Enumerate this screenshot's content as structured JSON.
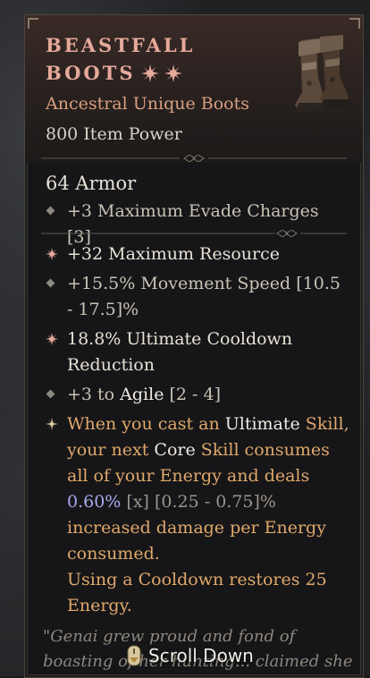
{
  "item": {
    "name_line1": "BEASTFALL",
    "name_line2": "BOOTS",
    "type": "Ancestral Unique Boots",
    "item_power": "800 Item Power",
    "armor": "64 Armor",
    "implicit": "+3 Maximum Evade Charges [3]",
    "affixes": [
      {
        "icon": "greater-affix-icon",
        "text": "+32 Maximum Resource"
      },
      {
        "icon": "diamond-bullet-icon",
        "text": "+15.5% Movement Speed [10.5 - 17.5]%"
      },
      {
        "icon": "greater-affix-icon",
        "text": "18.8% Ultimate Cooldown Reduction"
      },
      {
        "icon": "diamond-bullet-icon",
        "text_prefix": "+3 to ",
        "text_highlight": "Agile",
        "text_suffix": " [2 - 4]"
      }
    ],
    "unique_power": {
      "icon": "unique-star-icon",
      "p1": "When you cast an ",
      "p2": "Ultimate",
      "p3": " Skill,",
      "p4": "your next ",
      "p5": "Core",
      "p6": " Skill consumes all of your Energy and deals ",
      "value": "0.60%",
      "x_mark": "[x]",
      "range": " [0.25 - 0.75]%",
      "p7": " increased damage per Energy consumed.",
      "p8": "Using a Cooldown restores 25 Energy."
    },
    "flavor": "\"Genai grew proud and fond of boasting of her hunting... claimed she"
  },
  "controls": {
    "scroll_label": "Scroll Down"
  },
  "colors": {
    "title": "#e6a99a",
    "type": "#d89f80",
    "unique_text": "#e0a86b",
    "value_blue": "#a9a8f0"
  }
}
